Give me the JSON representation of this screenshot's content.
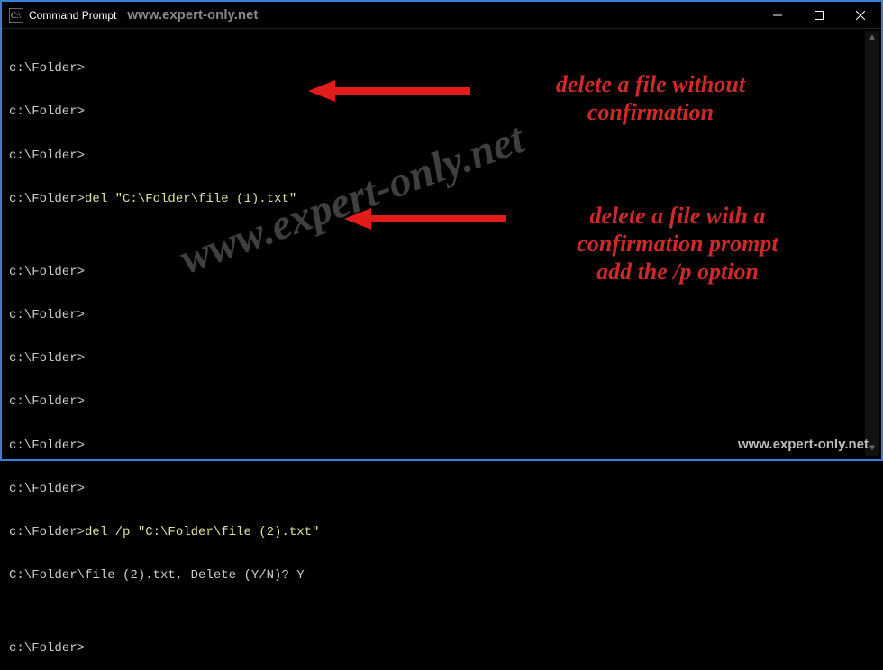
{
  "titlebar": {
    "title": "Command Prompt",
    "watermark": "www.expert-only.net"
  },
  "terminal": {
    "lines": [
      {
        "prompt": "c:\\Folder>",
        "cmd": ""
      },
      {
        "prompt": "c:\\Folder>",
        "cmd": ""
      },
      {
        "prompt": "c:\\Folder>",
        "cmd": ""
      },
      {
        "prompt": "c:\\Folder>",
        "cmd": "del \"C:\\Folder\\file (1).txt\""
      },
      {
        "prompt": "",
        "cmd": ""
      },
      {
        "prompt": "c:\\Folder>",
        "cmd": ""
      },
      {
        "prompt": "c:\\Folder>",
        "cmd": ""
      },
      {
        "prompt": "c:\\Folder>",
        "cmd": ""
      },
      {
        "prompt": "c:\\Folder>",
        "cmd": ""
      },
      {
        "prompt": "c:\\Folder>",
        "cmd": ""
      },
      {
        "prompt": "c:\\Folder>",
        "cmd": ""
      },
      {
        "prompt": "c:\\Folder>",
        "cmd": "del /p \"C:\\Folder\\file (2).txt\""
      },
      {
        "prompt": "C:\\Folder\\file (2).txt, Delete (Y/N)? ",
        "cmd": "Y"
      },
      {
        "prompt": "",
        "cmd": ""
      },
      {
        "prompt": "c:\\Folder>",
        "cmd": ""
      }
    ]
  },
  "annotations": {
    "a1_line1": "delete a file without",
    "a1_line2": "confirmation",
    "a2_line1": "delete a file with a",
    "a2_line2": "confirmation prompt",
    "a2_line3": "add the /p option"
  },
  "watermarks": {
    "diagonal": "www.expert-only.net",
    "bottom": "www.expert-only.net"
  }
}
